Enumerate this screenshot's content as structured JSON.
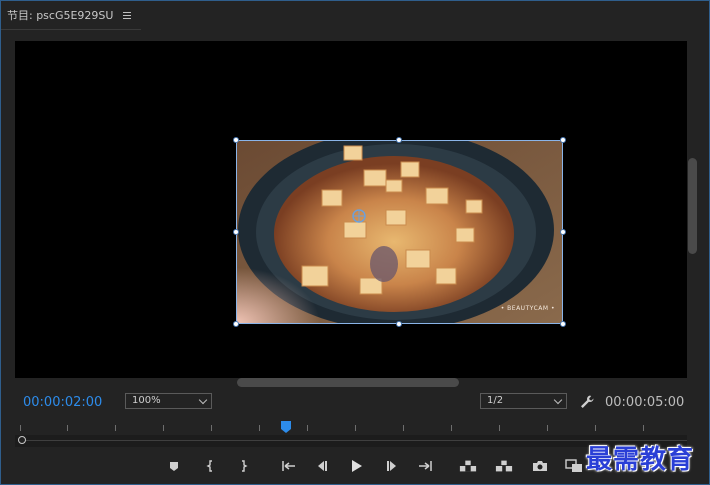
{
  "panel": {
    "title": "节目: pscG5E929SU",
    "menu_icon": "hamburger-icon"
  },
  "monitor": {
    "current_timecode": "00:00:02:00",
    "duration_timecode": "00:00:05:00",
    "zoom": {
      "value": "100%"
    },
    "resolution": {
      "value": "1/2"
    },
    "frame_watermark": "• BEAUTYCAM •"
  },
  "transport": {
    "buttons": [
      {
        "name": "add-marker-button",
        "icon": "marker-icon"
      },
      {
        "name": "mark-in-button",
        "icon": "mark-in-icon"
      },
      {
        "name": "mark-out-button",
        "icon": "mark-out-icon"
      },
      {
        "name": "go-to-in-button",
        "icon": "go-to-in-icon"
      },
      {
        "name": "step-back-button",
        "icon": "step-back-icon"
      },
      {
        "name": "play-button",
        "icon": "play-icon"
      },
      {
        "name": "step-forward-button",
        "icon": "step-forward-icon"
      },
      {
        "name": "go-to-out-button",
        "icon": "go-to-out-icon"
      },
      {
        "name": "lift-button",
        "icon": "lift-icon"
      },
      {
        "name": "extract-button",
        "icon": "extract-icon"
      },
      {
        "name": "export-frame-button",
        "icon": "camera-icon"
      },
      {
        "name": "comparison-view-button",
        "icon": "compare-icon"
      },
      {
        "name": "button-editor",
        "icon": "plus-icon"
      }
    ]
  },
  "brand": {
    "logo_text": "最需教育",
    "logo_color": "#2a3fd6"
  },
  "colors": {
    "accent": "#2d8ceb",
    "selection": "#8ab4e8"
  }
}
